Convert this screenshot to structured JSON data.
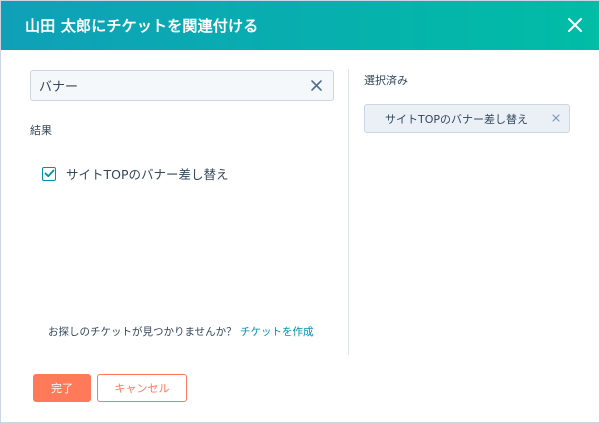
{
  "header": {
    "title": "山田 太郎にチケットを関連付ける",
    "close_icon": "close-icon"
  },
  "search": {
    "value": "バナー",
    "placeholder": "",
    "clear_icon": "clear-icon"
  },
  "results": {
    "label": "結果",
    "items": [
      {
        "label": "サイトTOPのバナー差し替え",
        "checked": true
      }
    ]
  },
  "not_found": {
    "text": "お探しのチケットが見つかりませんか？",
    "link_label": "チケットを作成"
  },
  "selected": {
    "label": "選択済み",
    "items": [
      {
        "label": "サイトTOPのバナー差し替え",
        "remove_label": "x"
      }
    ]
  },
  "footer": {
    "done_label": "完了",
    "cancel_label": "キャンセル"
  },
  "colors": {
    "header_gradient_start": "#0fa0b8",
    "header_gradient_end": "#00bda5",
    "primary": "#ff7a59",
    "link": "#0091ae",
    "text": "#33475b"
  }
}
